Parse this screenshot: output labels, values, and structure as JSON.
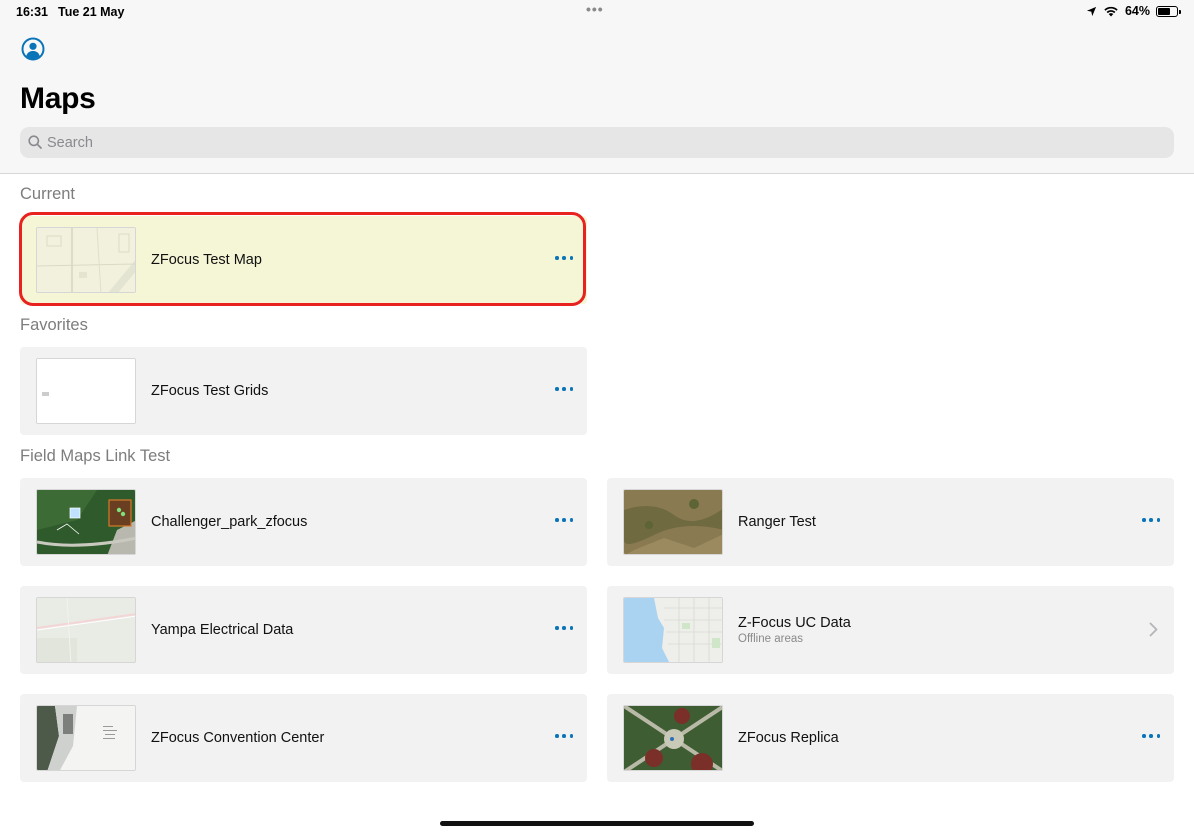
{
  "status_bar": {
    "time": "16:31",
    "date": "Tue 21 May",
    "multitask_dots": "•••",
    "battery_percent": "64%",
    "battery_level": 0.64
  },
  "header": {
    "title": "Maps",
    "search_placeholder": "Search"
  },
  "sections": {
    "current": {
      "label": "Current",
      "items": [
        {
          "title": "ZFocus Test Map",
          "thumbnail": "light-basemap"
        }
      ]
    },
    "favorites": {
      "label": "Favorites",
      "items": [
        {
          "title": "ZFocus Test Grids",
          "thumbnail": "blank-white"
        }
      ]
    },
    "field_maps_link_test": {
      "label": "Field Maps Link Test",
      "items": [
        {
          "title": "Challenger_park_zfocus",
          "thumbnail": "aerial-park"
        },
        {
          "title": "Ranger Test",
          "thumbnail": "aerial-terrain"
        },
        {
          "title": "Yampa Electrical Data",
          "thumbnail": "light-basemap"
        },
        {
          "title": "Z-Focus UC Data",
          "subtitle": "Offline areas",
          "thumbnail": "street-map-coast"
        },
        {
          "title": "ZFocus Convention Center",
          "thumbnail": "aerial-city"
        },
        {
          "title": "ZFocus Replica",
          "thumbnail": "aerial-park"
        }
      ]
    }
  },
  "accent_color": "#0a74b8",
  "highlight_color": "#e8231f",
  "current_card_color": "#f5f6d5"
}
